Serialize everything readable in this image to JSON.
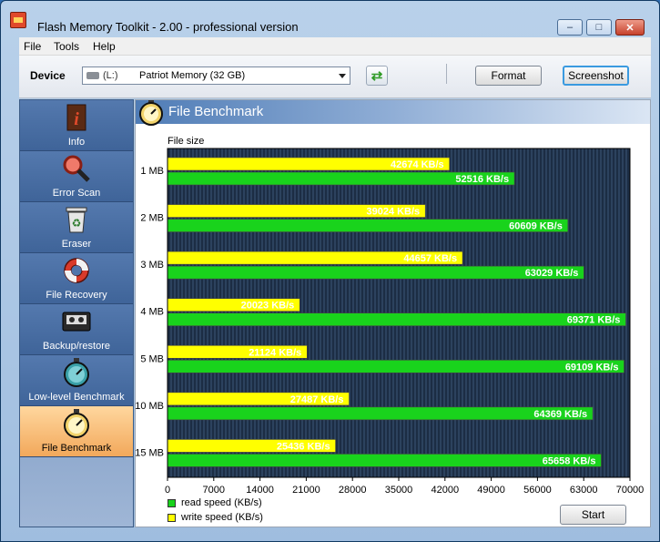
{
  "window": {
    "title": "Flash Memory Toolkit - 2.00 - professional version",
    "buttons": {
      "minimize": "–",
      "maximize": "□",
      "close": "✕"
    }
  },
  "menu": [
    "File",
    "Tools",
    "Help"
  ],
  "toolbar": {
    "device_label": "Device",
    "device_letter": "(L:)",
    "device_name": "Patriot Memory (32 GB)",
    "format_label": "Format",
    "screenshot_label": "Screenshot"
  },
  "sidebar": {
    "items": [
      {
        "label": "Info",
        "icon": "info-icon"
      },
      {
        "label": "Error Scan",
        "icon": "magnifier-icon"
      },
      {
        "label": "Eraser",
        "icon": "recycle-bin-icon"
      },
      {
        "label": "File Recovery",
        "icon": "lifebuoy-icon"
      },
      {
        "label": "Backup/restore",
        "icon": "cassette-icon"
      },
      {
        "label": "Low-level Benchmark",
        "icon": "stopwatch-icon"
      },
      {
        "label": "File Benchmark",
        "icon": "stopwatch-icon"
      }
    ],
    "active_index": 6
  },
  "panel": {
    "title": "File Benchmark"
  },
  "chart_data": {
    "type": "bar",
    "orientation": "horizontal",
    "ylabel": "File size",
    "categories": [
      "1 MB",
      "2 MB",
      "3 MB",
      "4 MB",
      "5 MB",
      "10 MB",
      "15 MB"
    ],
    "series": [
      {
        "name": "write speed (KB/s)",
        "color": "#ffff00",
        "values": [
          42674,
          39024,
          44657,
          20023,
          21124,
          27487,
          25436
        ]
      },
      {
        "name": "read speed (KB/s)",
        "color": "#19d31c",
        "values": [
          52516,
          60609,
          63029,
          69371,
          69109,
          64369,
          65658
        ]
      }
    ],
    "value_unit": "KB/s",
    "xlim": [
      0,
      70000
    ],
    "xticks": [
      0,
      7000,
      14000,
      21000,
      28000,
      35000,
      42000,
      49000,
      56000,
      63000,
      70000
    ],
    "plot_background": "#1c2d44",
    "grid": "vertical",
    "legend": "bottom-left"
  },
  "legend": [
    {
      "label": "read speed (KB/s)",
      "color": "#19d31c"
    },
    {
      "label": "write speed (KB/s)",
      "color": "#ffff00"
    }
  ],
  "start_label": "Start"
}
